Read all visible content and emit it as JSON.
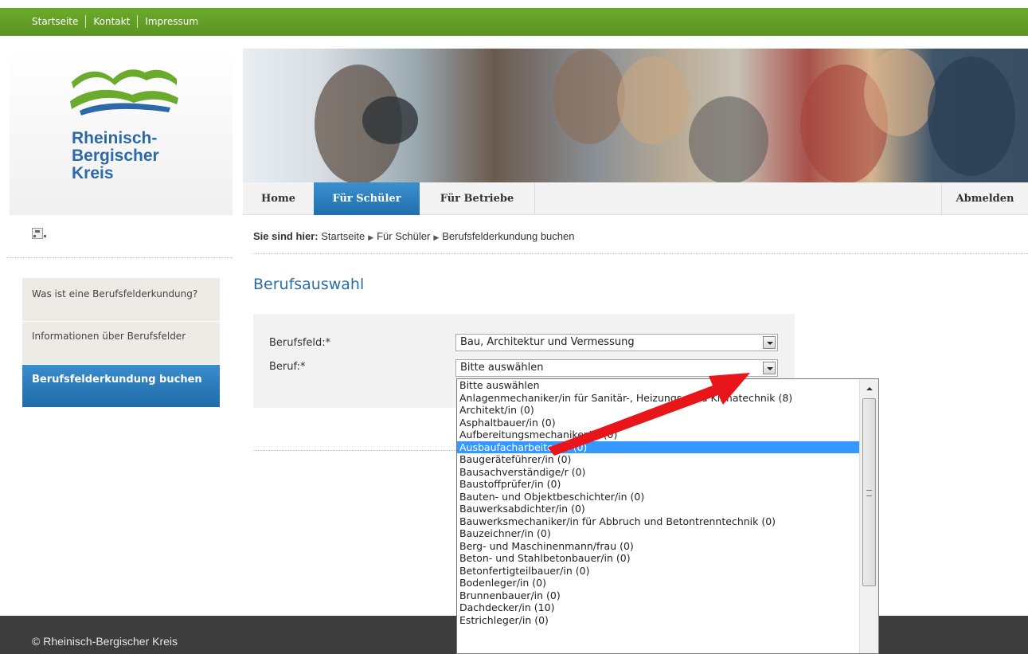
{
  "topnav": {
    "items": [
      "Startseite",
      "Kontakt",
      "Impressum"
    ]
  },
  "logo": {
    "lines": [
      "Rheinisch-",
      "Bergischer",
      "Kreis"
    ]
  },
  "mainnav": {
    "home": "Home",
    "schueler": "Für Schüler",
    "betriebe": "Für Betriebe",
    "abmelden": "Abmelden"
  },
  "breadcrumb": {
    "prefix": "Sie sind hier:",
    "items": [
      "Startseite",
      "Für Schüler",
      "Berufsfelderkundung buchen"
    ]
  },
  "sidebar": {
    "items": [
      {
        "label": "Was ist eine Berufsfelderkundung?"
      },
      {
        "label": "Informationen über Berufsfelder"
      },
      {
        "label": "Berufsfelderkundung buchen"
      }
    ]
  },
  "page": {
    "heading": "Berufsauswahl"
  },
  "form": {
    "berufsfeld_label": "Berufsfeld:*",
    "berufsfeld_value": "Bau, Architektur und Vermessung",
    "beruf_label": "Beruf:*",
    "beruf_value": "Bitte auswählen"
  },
  "dropdown": {
    "options": [
      "Bitte auswählen",
      "Anlagenmechaniker/in für Sanitär-, Heizungs- und Klimatechnik (8)",
      "Architekt/in (0)",
      "Asphaltbauer/in (0)",
      "Aufbereitungsmechaniker/in (0)",
      "Ausbaufacharbeiter/in (0)",
      "Baugeräteführer/in (0)",
      "Bausachverständige/r (0)",
      "Baustoffprüfer/in (0)",
      "Bauten- und Objektbeschichter/in (0)",
      "Bauwerksabdichter/in (0)",
      "Bauwerksmechaniker/in für Abbruch und Betontrenntechnik (0)",
      "Bauzeichner/in (0)",
      "Berg- und Maschinenmann/frau (0)",
      "Beton- und Stahlbetonbauer/in (0)",
      "Betonfertigteilbauer/in (0)",
      "Bodenleger/in (0)",
      "Brunnenbauer/in (0)",
      "Dachdecker/in (10)",
      "Estrichleger/in (0)"
    ],
    "selected_index": 5
  },
  "footer": {
    "text": "© Rheinisch-Bergischer Kreis"
  },
  "colors": {
    "top_green": "#5f9c24",
    "accent_blue": "#2a6ea6",
    "nav_active": "#2b7cbd",
    "selection": "#3399ff",
    "footer": "#3d3d3d",
    "annotation_arrow": "#e8151b"
  }
}
